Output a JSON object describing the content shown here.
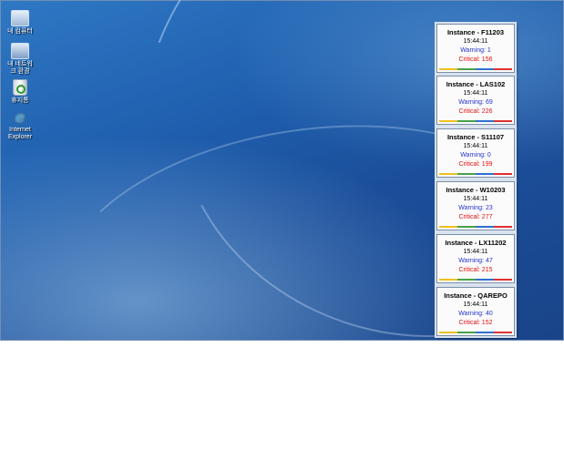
{
  "desktop": {
    "icons": [
      {
        "label": "내 컴퓨터",
        "icon": "my-computer-icon"
      },
      {
        "label": "내 네트워크 환경",
        "icon": "network-places-icon"
      },
      {
        "label": "휴지통",
        "icon": "recycle-bin-icon"
      },
      {
        "label": "Internet Explorer",
        "icon": "internet-explorer-icon"
      }
    ]
  },
  "alerts": [
    {
      "title": "Instance - F11203",
      "time": "15:44:11",
      "warning": "Warning: 1",
      "critical": "Critical: 156"
    },
    {
      "title": "Instance - LAS102",
      "time": "15:44:11",
      "warning": "Warning: 69",
      "critical": "Critical: 226"
    },
    {
      "title": "Instance - S11107",
      "time": "15:44:11",
      "warning": "Warning: 0",
      "critical": "Critical: 199"
    },
    {
      "title": "Instance - W10203",
      "time": "15:44:11",
      "warning": "Warning: 23",
      "critical": "Critical: 277"
    },
    {
      "title": "Instance - LX11202",
      "time": "15:44:11",
      "warning": "Warning: 47",
      "critical": "Critical: 215"
    },
    {
      "title": "Instance - QAREPO",
      "time": "15:44:11",
      "warning": "Warning: 40",
      "critical": "Critical: 152"
    }
  ],
  "colors": {
    "warning_text": "#2233cc",
    "critical_text": "#e01010",
    "desktop_blue": "#1f5fae"
  }
}
